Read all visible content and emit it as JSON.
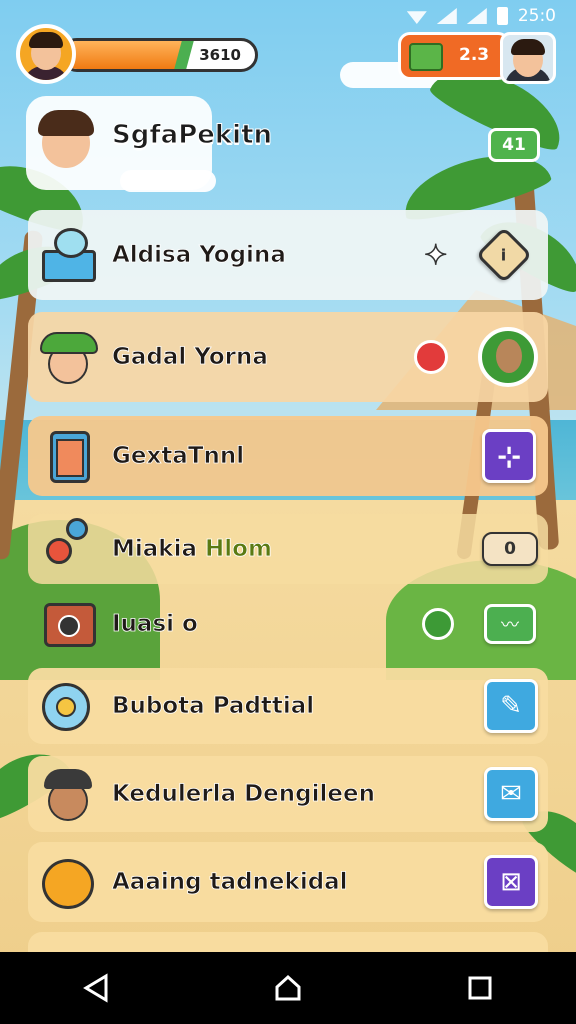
{
  "status_bar": {
    "time": "25:0"
  },
  "hud": {
    "xp_text": "3610",
    "xp_progress": 0.62,
    "coins": "2.3"
  },
  "header": {
    "title": "SgfaPekitn",
    "badge": "41"
  },
  "rows": [
    {
      "label": "Aldisa Yogina",
      "icon": "gift-cat-icon"
    },
    {
      "label": "Gadal Yorna",
      "icon": "explorer-kid-icon",
      "status": "stop-indicator"
    },
    {
      "label": "GextaTnnl",
      "icon": "clipboard-icon"
    },
    {
      "label": "Miakia",
      "label_highlight": "Hlom",
      "icon": "toy-icon",
      "tag": "0"
    },
    {
      "label": "Iuasi o",
      "icon": "radio-icon"
    },
    {
      "label": "Bubota Padttial",
      "icon": "flower-icon"
    },
    {
      "label": "Kedulerla Dengileen",
      "icon": "boy-cap-icon"
    },
    {
      "label": "Aaaing tadnekidal",
      "icon": "bear-icon"
    }
  ],
  "colors": {
    "accent_orange": "#f07a12",
    "green": "#4caf50",
    "purple": "#6b3fc4",
    "blue": "#3fa9e0"
  },
  "navigation": {
    "back_icon": "back-triangle-icon",
    "home_icon": "home-icon",
    "recents_icon": "recents-square-icon"
  }
}
